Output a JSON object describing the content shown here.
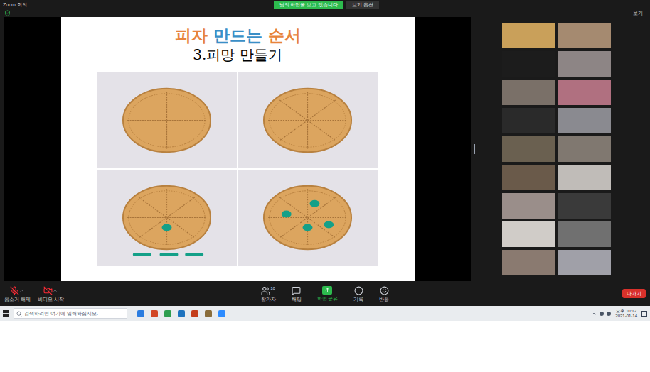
{
  "window": {
    "title": "Zoom 회의"
  },
  "banner": {
    "text": "님의 화면을 보고 있습니다",
    "options": "보기 옵션"
  },
  "view_button": "보기",
  "slide": {
    "title_parts": [
      {
        "text": "피자",
        "color": "#e8843c"
      },
      {
        "text": "만드는",
        "color": "#3a8fc7"
      },
      {
        "text": "순서",
        "color": "#e8843c"
      }
    ],
    "subtitle": "3.피망 만들기"
  },
  "participants": [
    {
      "color": "#c9a05a"
    },
    {
      "color": "#a58a70"
    },
    {
      "color": "#1c1c1c"
    },
    {
      "color": "#8d8585"
    },
    {
      "color": "#7a7068"
    },
    {
      "color": "#b07080"
    },
    {
      "color": "#2a2a2a"
    },
    {
      "color": "#8a8a90"
    },
    {
      "color": "#6a6050"
    },
    {
      "color": "#807870"
    },
    {
      "color": "#6a5a4a"
    },
    {
      "color": "#c0bcb8"
    },
    {
      "color": "#9a8e8a"
    },
    {
      "color": "#3a3a3a"
    },
    {
      "color": "#d0ccc8"
    },
    {
      "color": "#707070"
    },
    {
      "color": "#8a7a70"
    },
    {
      "color": "#a0a0a8"
    }
  ],
  "toolbar": {
    "left": [
      {
        "label": "음소거 해제",
        "kind": "mic"
      },
      {
        "label": "비디오 시작",
        "kind": "video"
      }
    ],
    "center": [
      {
        "label": "참가자",
        "kind": "users",
        "count": "10",
        "selected": false
      },
      {
        "label": "채팅",
        "kind": "chat",
        "selected": false
      },
      {
        "label": "화면 공유",
        "kind": "share",
        "selected": true
      },
      {
        "label": "기록",
        "kind": "record",
        "selected": false
      },
      {
        "label": "반응",
        "kind": "react",
        "selected": false
      }
    ],
    "leave": "나가기"
  },
  "taskbar": {
    "search_placeholder": "검색하려면 여기에 입력하십시오.",
    "time": "오후 10:12",
    "date": "2021-01-14"
  }
}
